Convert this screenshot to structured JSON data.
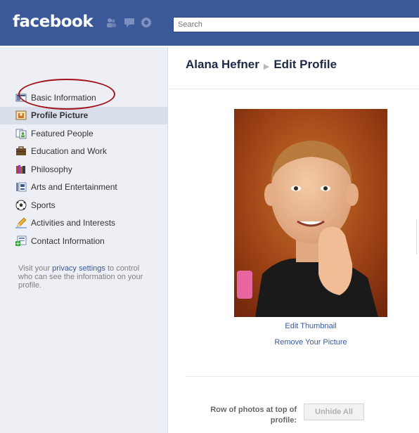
{
  "topbar": {
    "logo": "facebook",
    "search": {
      "placeholder": "Search",
      "value": ""
    }
  },
  "breadcrumb": {
    "user": "Alana Hefner",
    "page": "Edit Profile"
  },
  "sidebar": {
    "items": [
      {
        "label": "Basic Information",
        "icon": "basic-info-icon",
        "selected": false
      },
      {
        "label": "Profile Picture",
        "icon": "profile-picture-icon",
        "selected": true
      },
      {
        "label": "Featured People",
        "icon": "featured-people-icon",
        "selected": false
      },
      {
        "label": "Education and Work",
        "icon": "briefcase-icon",
        "selected": false
      },
      {
        "label": "Philosophy",
        "icon": "books-icon",
        "selected": false
      },
      {
        "label": "Arts and Entertainment",
        "icon": "arts-icon",
        "selected": false
      },
      {
        "label": "Sports",
        "icon": "soccer-ball-icon",
        "selected": false
      },
      {
        "label": "Activities and Interests",
        "icon": "pencil-icon",
        "selected": false
      },
      {
        "label": "Contact Information",
        "icon": "contact-card-icon",
        "selected": false
      }
    ],
    "privacy_prefix": "Visit your ",
    "privacy_link": "privacy settings",
    "privacy_suffix": " to control who can see the information on your profile."
  },
  "main": {
    "edit_thumbnail": "Edit Thumbnail",
    "remove_picture": "Remove Your Picture",
    "row_label": "Row of photos at top of profile:",
    "unhide_button": "Unhide All"
  },
  "colors": {
    "brand_blue": "#3b5998",
    "sidebar_bg": "#edeff4",
    "selected_bg": "#d8dfea",
    "annotation_red": "#a3121a"
  }
}
